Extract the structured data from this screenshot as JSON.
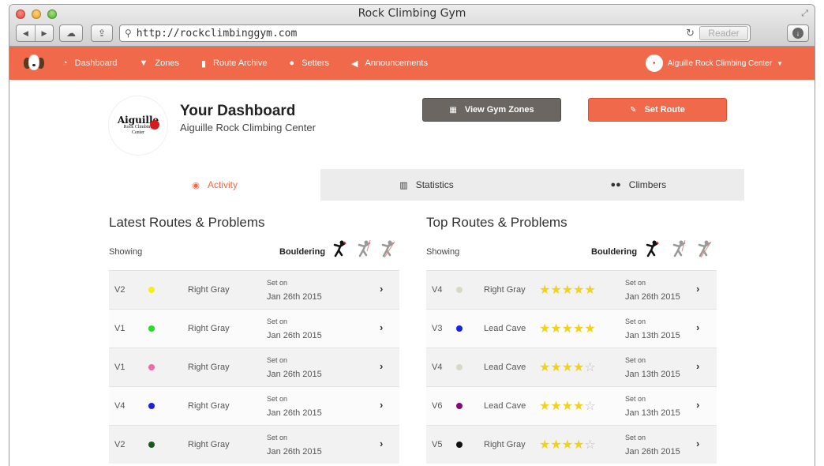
{
  "browser": {
    "window_title": "Rock Climbing Gym",
    "url": "http://rockclimbinggym.com",
    "reader_label": "Reader"
  },
  "nav": {
    "items": [
      {
        "label": "Dashboard",
        "icon": "dashboard-icon",
        "glyph": "◔"
      },
      {
        "label": "Zones",
        "icon": "zones-icon",
        "glyph": "▼"
      },
      {
        "label": "Route Archive",
        "icon": "book-icon",
        "glyph": "▮"
      },
      {
        "label": "Setters",
        "icon": "users-icon",
        "glyph": "●"
      },
      {
        "label": "Announcements",
        "icon": "megaphone-icon",
        "glyph": "◀"
      }
    ],
    "gym_name": "Aiguille Rock Climbing Center",
    "accent_color": "#f0694a"
  },
  "header": {
    "logo_text_big": "Aiguille",
    "logo_text_small": "Rock Climbing",
    "logo_text_small2": "Center",
    "title": "Your Dashboard",
    "subtitle": "Aiguille Rock Climbing Center",
    "view_zones_label": "View Gym Zones",
    "set_route_label": "Set Route"
  },
  "tabs": [
    {
      "label": "Activity",
      "icon": "activity-icon",
      "active": true
    },
    {
      "label": "Statistics",
      "icon": "bar-chart-icon",
      "active": false
    },
    {
      "label": "Climbers",
      "icon": "group-icon",
      "active": false
    }
  ],
  "latest": {
    "title": "Latest Routes & Problems",
    "showing_label": "Showing",
    "filter_label": "Bouldering",
    "rows": [
      {
        "grade": "V2",
        "color": "#f5f00f",
        "location": "Right Gray",
        "set_label": "Set on",
        "date": "Jan 26th 2015"
      },
      {
        "grade": "V1",
        "color": "#22e022",
        "location": "Right Gray",
        "set_label": "Set on",
        "date": "Jan 26th 2015"
      },
      {
        "grade": "V1",
        "color": "#f06aaa",
        "location": "Right Gray",
        "set_label": "Set on",
        "date": "Jan 26th 2015"
      },
      {
        "grade": "V4",
        "color": "#1a22e0",
        "location": "Right Gray",
        "set_label": "Set on",
        "date": "Jan 26th 2015"
      },
      {
        "grade": "V2",
        "color": "#145a1e",
        "location": "Right Gray",
        "set_label": "Set on",
        "date": "Jan 26th 2015"
      }
    ]
  },
  "top": {
    "title": "Top Routes & Problems",
    "showing_label": "Showing",
    "filter_label": "Bouldering",
    "rows": [
      {
        "grade": "V4",
        "color": "#d8d8c8",
        "location": "Right Gray",
        "rating": 5,
        "set_label": "Set on",
        "date": "Jan 26th 2015"
      },
      {
        "grade": "V3",
        "color": "#1a22e0",
        "location": "Lead Cave",
        "rating": 5,
        "set_label": "Set on",
        "date": "Jan 13th 2015"
      },
      {
        "grade": "V4",
        "color": "#d8d8c8",
        "location": "Lead Cave",
        "rating": 4,
        "set_label": "Set on",
        "date": "Jan 13th 2015"
      },
      {
        "grade": "V6",
        "color": "#800a7a",
        "location": "Lead Cave",
        "rating": 4,
        "set_label": "Set on",
        "date": "Jan 13th 2015"
      },
      {
        "grade": "V5",
        "color": "#111111",
        "location": "Right Gray",
        "rating": 4,
        "set_label": "Set on",
        "date": "Jan 26th 2015"
      }
    ]
  }
}
